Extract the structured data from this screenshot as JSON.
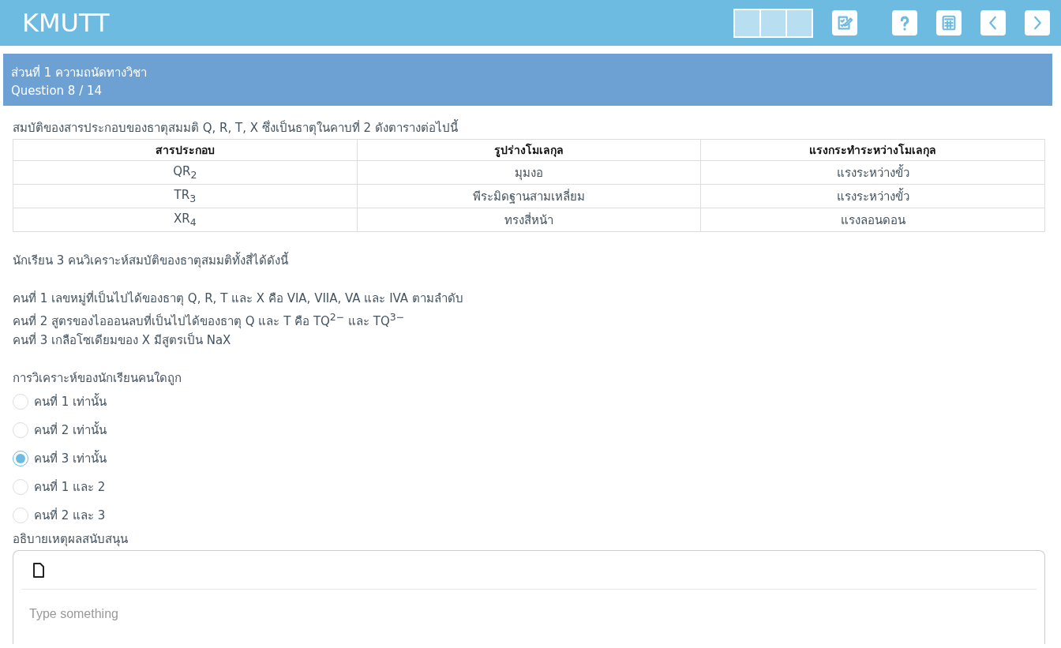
{
  "app_bar": {
    "title": "KMUTT"
  },
  "section_header": {
    "section": "ส่วนที่ 1 ความถนัดทางวิชา",
    "question": "Question 8 / 14"
  },
  "intro": "สมบัติของสารประกอบของธาตุสมมติ Q, R, T, X ซึ่งเป็นธาตุในคาบที่ 2 ดังตารางต่อไปนี้",
  "table": {
    "columns": [
      "สารประกอบ",
      "รูปร่างโมเลกุล",
      "แรงกระทำระหว่างโมเลกุล"
    ],
    "rows": [
      [
        "QR$_{2}$",
        "มุมงอ",
        "แรงระหว่างขั้ว"
      ],
      [
        "TR$_{3}$",
        "พีระมิดฐานสามเหลี่ยม",
        "แรงระหว่างขั้ว"
      ],
      [
        "XR$_{4}$",
        "ทรงสี่หน้า",
        "แรงลอนดอน"
      ]
    ]
  },
  "analysis_intro": "นักเรียน 3 คนวิเคราะห์สมบัติของธาตุสมมติทั้งสี่ได้ดังนี้",
  "statements": [
    "คนที่ 1 เลขหมู่ที่เป็นไปได้ของธาตุ Q, R, T และ X คือ VIA, VIIA, VA และ IVA ตามลำดับ",
    "คนที่ 2 สูตรของไอออนลบที่เป็นไปได้ของธาตุ Q และ T คือ TQ$^{2−}$ และ TQ$^{3−}$",
    "คนที่ 3 เกลือโซเดียมของ X มีสูตรเป็น NaX"
  ],
  "question": "การวิเคราะห์ของนักเรียนคนใดถูก",
  "options": [
    {
      "label": "คนที่ 1 เท่านั้น",
      "selected": false
    },
    {
      "label": "คนที่ 2 เท่านั้น",
      "selected": false
    },
    {
      "label": "คนที่ 3 เท่านั้น",
      "selected": true
    },
    {
      "label": "คนที่ 1 และ 2",
      "selected": false
    },
    {
      "label": "คนที่ 2 และ 3",
      "selected": false
    }
  ],
  "explanation": {
    "label": "อธิบายเหตุผลสนับสนุน",
    "placeholder": "Type something"
  }
}
